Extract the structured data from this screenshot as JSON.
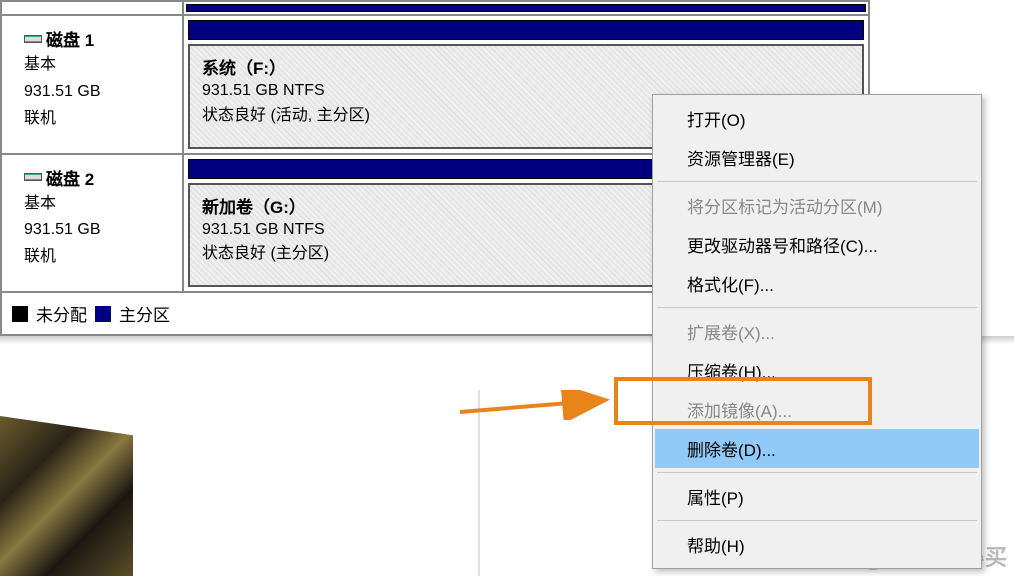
{
  "disks": [
    {
      "title": "磁盘 1",
      "type": "基本",
      "size": "931.51 GB",
      "status": "联机",
      "volume": {
        "name": "系统（F:）",
        "size_fs": "931.51 GB NTFS",
        "state": "状态良好 (活动, 主分区)"
      }
    },
    {
      "title": "磁盘 2",
      "type": "基本",
      "size": "931.51 GB",
      "status": "联机",
      "volume": {
        "name": "新加卷（G:）",
        "size_fs": "931.51 GB NTFS",
        "state": "状态良好 (主分区)"
      }
    }
  ],
  "legend": {
    "unallocated": "未分配",
    "primary": "主分区"
  },
  "menu": {
    "open": "打开(O)",
    "explorer": "资源管理器(E)",
    "mark_active": "将分区标记为活动分区(M)",
    "change_drive": "更改驱动器号和路径(C)...",
    "format": "格式化(F)...",
    "extend": "扩展卷(X)...",
    "shrink": "压缩卷(H)...",
    "mirror": "添加镜像(A)...",
    "delete": "删除卷(D)...",
    "properties": "属性(P)",
    "help": "帮助(H)"
  },
  "watermark": "什么值得买"
}
